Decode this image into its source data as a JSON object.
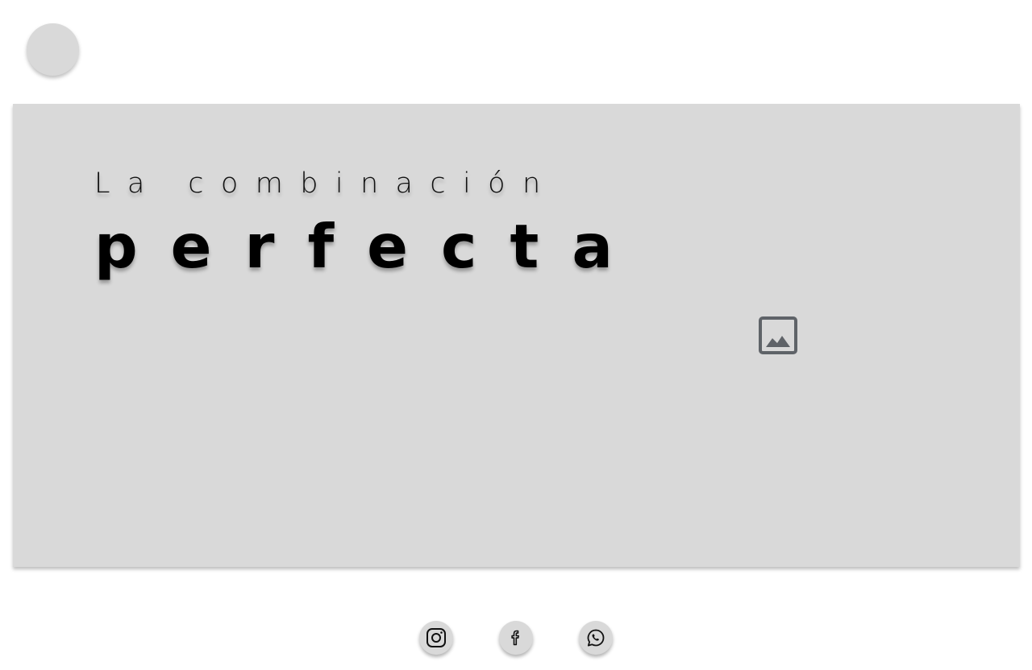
{
  "header": {
    "logo_icon": "circle-logo-placeholder"
  },
  "hero": {
    "subtitle": "La combinación",
    "title": "perfecta",
    "background_color": "#d9d9d9",
    "image_icon": "image-placeholder-icon"
  },
  "social": {
    "items": [
      {
        "icon": "instagram-icon"
      },
      {
        "icon": "facebook-icon"
      },
      {
        "icon": "whatsapp-icon"
      }
    ]
  }
}
